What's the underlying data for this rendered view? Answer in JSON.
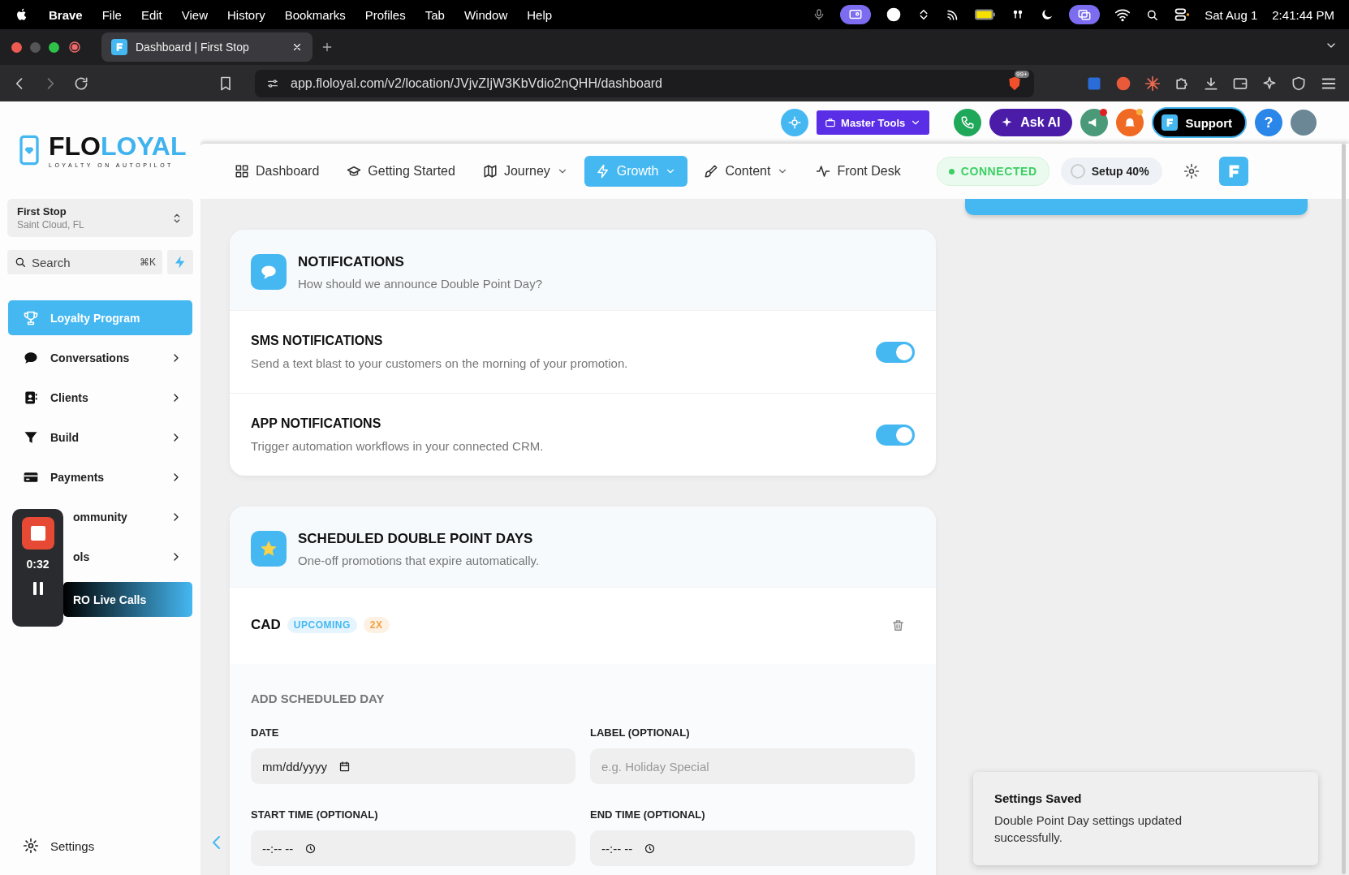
{
  "menubar": {
    "app": "Brave",
    "menus": [
      "File",
      "Edit",
      "View",
      "History",
      "Bookmarks",
      "Profiles",
      "Tab",
      "Window",
      "Help"
    ],
    "date": "Sat Aug 1",
    "time": "2:41:44 PM"
  },
  "browser": {
    "tab_title": "Dashboard | First Stop",
    "url": "app.floloyal.com/v2/location/JVjvZIjW3KbVdio2nQHH/dashboard",
    "shields_badge": "99+"
  },
  "logo": {
    "part1": "FLO",
    "part2": "LOYAL",
    "tagline": "LOYALTY ON AUTOPILOT"
  },
  "topbar": {
    "master_tools": "Master Tools",
    "ask_ai": "Ask AI",
    "support": "Support",
    "help": "?"
  },
  "nav": {
    "items": [
      {
        "label": "Dashboard",
        "dropdown": false,
        "selected": false
      },
      {
        "label": "Getting Started",
        "dropdown": false,
        "selected": false
      },
      {
        "label": "Journey",
        "dropdown": true,
        "selected": false
      },
      {
        "label": "Growth",
        "dropdown": true,
        "selected": true
      },
      {
        "label": "Content",
        "dropdown": true,
        "selected": false
      },
      {
        "label": "Front Desk",
        "dropdown": false,
        "selected": false
      }
    ],
    "status": "CONNECTED",
    "setup": "Setup 40%"
  },
  "sidebar": {
    "location": {
      "name": "First Stop",
      "city": "Saint Cloud, FL"
    },
    "search": {
      "placeholder": "Search",
      "shortcut": "⌘K"
    },
    "items": [
      {
        "label": "Loyalty Program",
        "kind": "link",
        "selected": true,
        "covered": false
      },
      {
        "label": "Conversations",
        "kind": "group",
        "selected": false,
        "covered": false
      },
      {
        "label": "Clients",
        "kind": "group",
        "selected": false,
        "covered": false
      },
      {
        "label": "Build",
        "kind": "group",
        "selected": false,
        "covered": false
      },
      {
        "label": "Payments",
        "kind": "group",
        "selected": false,
        "covered": false
      },
      {
        "label": "ommunity",
        "kind": "group",
        "selected": false,
        "covered": true
      },
      {
        "label": "ols",
        "kind": "group",
        "selected": false,
        "covered": true
      },
      {
        "label": "RO Live Calls",
        "kind": "promo",
        "selected": false,
        "covered": true
      }
    ],
    "settings": "Settings"
  },
  "recorder": {
    "elapsed": "0:32"
  },
  "notifications": {
    "title": "NOTIFICATIONS",
    "subtitle": "How should we announce Double Point Day?",
    "rows": [
      {
        "title": "SMS NOTIFICATIONS",
        "description": "Send a text blast to your customers on the morning of your promotion.",
        "on": true
      },
      {
        "title": "APP NOTIFICATIONS",
        "description": "Trigger automation workflows in your connected CRM.",
        "on": true
      }
    ]
  },
  "scheduled": {
    "title": "SCHEDULED DOUBLE POINT DAYS",
    "subtitle": "One-off promotions that expire automatically.",
    "entries": [
      {
        "label": "CAD",
        "status": "UPCOMING",
        "multiplier": "2X"
      }
    ],
    "form": {
      "heading": "ADD SCHEDULED DAY",
      "fields": [
        {
          "label": "DATE",
          "kind": "date",
          "value": "mm/dd/yyyy"
        },
        {
          "label": "LABEL (OPTIONAL)",
          "kind": "text",
          "placeholder": "e.g. Holiday Special"
        },
        {
          "label": "START TIME (OPTIONAL)",
          "kind": "time",
          "value": "--:-- --"
        },
        {
          "label": "END TIME (OPTIONAL)",
          "kind": "time",
          "value": "--:-- --"
        }
      ]
    }
  },
  "toast": {
    "title": "Settings Saved",
    "message": "Double Point Day settings updated successfully."
  }
}
